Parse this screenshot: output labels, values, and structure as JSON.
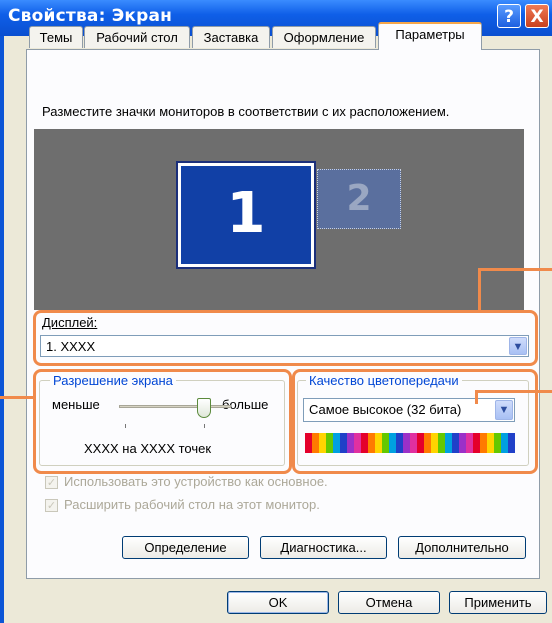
{
  "window": {
    "title": "Свойства: Экран",
    "help_label": "?",
    "close_label": "X"
  },
  "tabs": [
    {
      "label": "Темы"
    },
    {
      "label": "Рабочий стол"
    },
    {
      "label": "Заставка"
    },
    {
      "label": "Оформление"
    },
    {
      "label": "Параметры",
      "active": true
    }
  ],
  "instructions": "Разместите значки мониторов в соответствии с их расположением.",
  "monitors": [
    {
      "number": "1",
      "selected": true
    },
    {
      "number": "2",
      "selected": false
    }
  ],
  "display": {
    "label": "Дисплей:",
    "value": "1. XXXX"
  },
  "resolution": {
    "group_label": "Разрешение экрана",
    "less_label": "меньше",
    "more_label": "больше",
    "value_text": "XXXX на XXXX точек",
    "slider_fraction": 0.8
  },
  "color_quality": {
    "group_label": "Качество цветопередачи",
    "value": "Самое высокое (32 бита)"
  },
  "checkboxes": [
    {
      "label": "Использовать это устройство как основное.",
      "checked": true,
      "enabled": false
    },
    {
      "label": "Расширить рабочий стол на этот монитор.",
      "checked": true,
      "enabled": false
    }
  ],
  "panel_buttons": {
    "identify": "Определение",
    "troubleshoot": "Диагностика...",
    "advanced": "Дополнительно"
  },
  "dialog_buttons": {
    "ok": "OK",
    "cancel": "Отмена",
    "apply": "Применить"
  },
  "colors": {
    "title_bar": "#0a4fd0",
    "dialog_bg": "#ece9d8",
    "highlight": "#f08a4b",
    "monitor_selected": "#1140a6"
  },
  "icons": {
    "help": "question-mark-icon",
    "close": "close-icon",
    "dropdown": "chevron-down-icon",
    "checkbox": "check-icon"
  }
}
